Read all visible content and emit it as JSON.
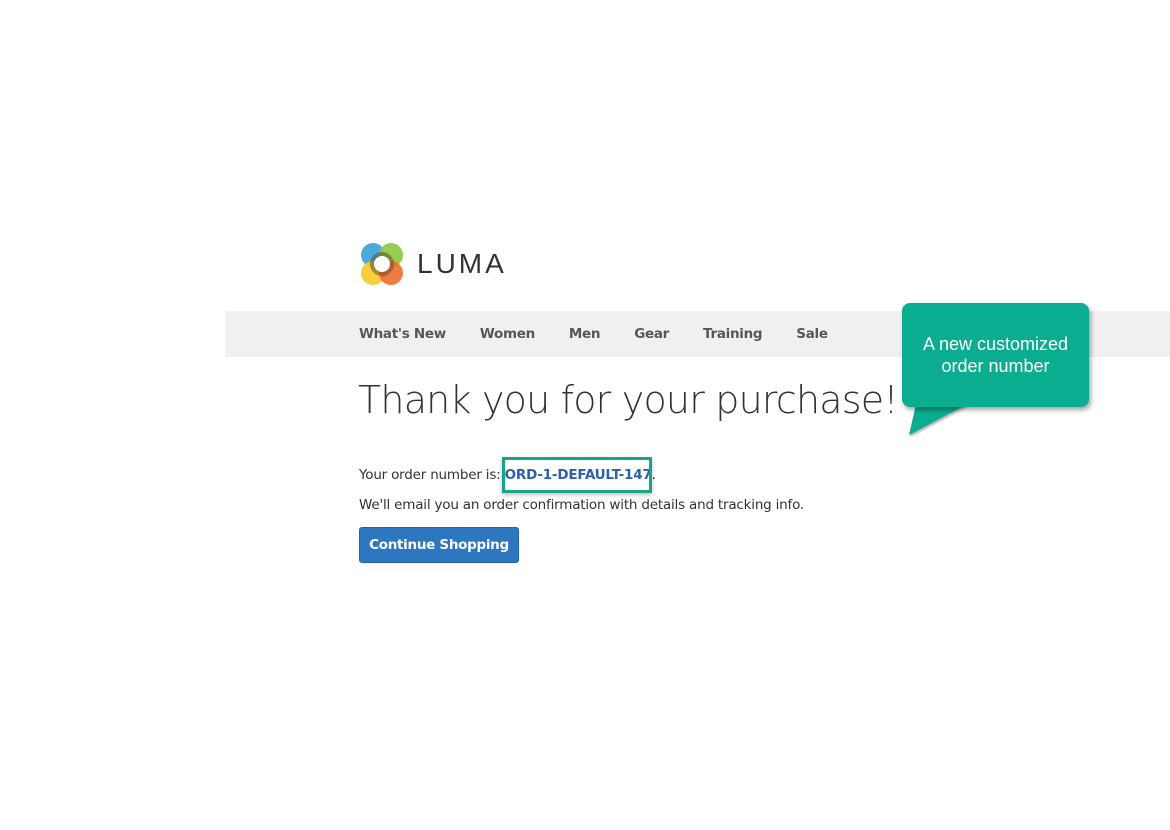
{
  "brand": {
    "name": "LUMA",
    "logo_colors": [
      "#3fa6d9",
      "#8dc63f",
      "#f5c929",
      "#f06d2b"
    ]
  },
  "nav": {
    "items": [
      {
        "label": "What's New"
      },
      {
        "label": "Women"
      },
      {
        "label": "Men"
      },
      {
        "label": "Gear"
      },
      {
        "label": "Training"
      },
      {
        "label": "Sale"
      }
    ]
  },
  "main": {
    "title": "Thank you for your purchase!",
    "order_prefix": "Your order number is: ",
    "order_number": "ORD-1-DEFAULT-147",
    "order_suffix": ".",
    "email_text": "We'll email you an order confirmation with details and tracking info.",
    "continue_label": "Continue Shopping"
  },
  "annotation": {
    "callout_line1": "A new customized",
    "callout_line2": "order number",
    "accent_color": "#0aad8f"
  }
}
